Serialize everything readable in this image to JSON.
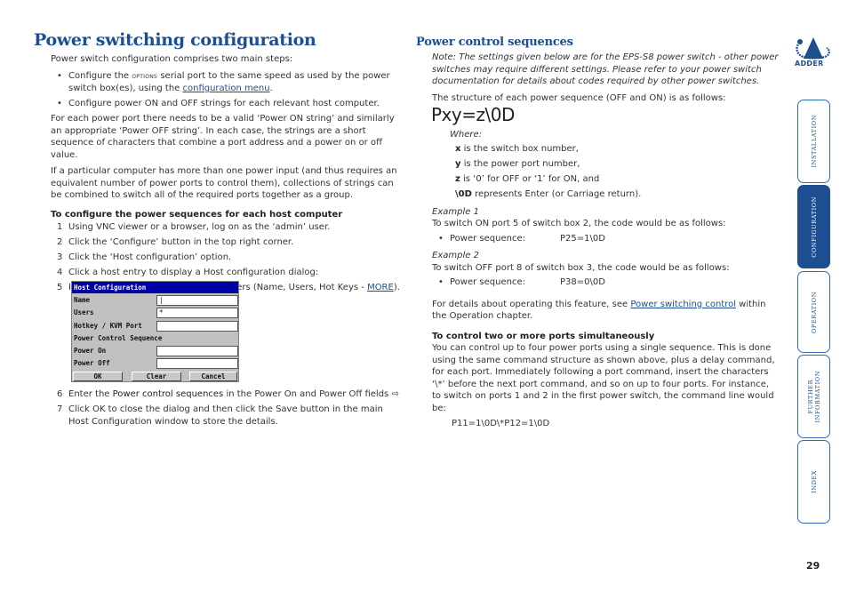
{
  "left": {
    "title": "Power switching configuration",
    "intro": "Power switch configuration comprises two main steps:",
    "bullet1_pre": "Configure the ",
    "bullet1_smallcaps": "options",
    "bullet1_mid": " serial port to the same speed as used by the power switch box(es), using the ",
    "bullet1_link": "configuration menu",
    "bullet1_post": ".",
    "bullet2": "Configure power ON and OFF strings for each relevant host computer.",
    "para1": "For each power port there needs to be a valid ‘Power ON string’ and similarly an appropriate ‘Power OFF string’. In each case, the strings are a short sequence of characters that combine a port address and a power on or off value.",
    "para2": "If a particular computer has more than one power input (and thus requires an equivalent number of power ports to control them), collections of strings can be combined to switch all of the required ports together as a group.",
    "procedure_heading": "To configure the power sequences for each host computer",
    "steps": [
      {
        "num": "1",
        "text": "Using VNC viewer or a browser, log on as the ‘admin’ user."
      },
      {
        "num": "2",
        "text": "Click the ‘Configure’ button in the top right corner."
      },
      {
        "num": "3",
        "text": "Click the ‘Host configuration’ option."
      },
      {
        "num": "4",
        "text": "Click a host entry to display a Host configuration dialog:"
      },
      {
        "num": "5",
        "text_pre": "If necessary, configure other parameters (Name, Users, Hot Keys - ",
        "link": "MORE",
        "text_post": ")."
      }
    ],
    "step6": {
      "num": "6",
      "pre": "Enter the ",
      "bold": "Power control sequences",
      "post": " in the Power On and Power Off fields ⇨"
    },
    "step7": {
      "num": "7",
      "text": "Click OK to close the dialog and then click the Save button in the main Host Configuration window to store the details."
    }
  },
  "dialog": {
    "title": "Host Configuration",
    "name_label": "Name",
    "name_value": "|",
    "users_label": "Users",
    "users_value": "*",
    "hotkey_label": "Hotkey / KVM Port",
    "hotkey_value": "",
    "section_label": "Power Control Sequence",
    "power_on_label": "Power On",
    "power_on_value": "",
    "power_off_label": "Power Off",
    "power_off_value": "",
    "ok": "OK",
    "clear": "Clear",
    "cancel": "Cancel"
  },
  "right": {
    "title": "Power control sequences",
    "note": "Note: The settings given below are for the EPS-S8 power switch - other power switches may require different settings. Please refer to your power switch documentation for details about codes required by other power switches.",
    "structure": "The structure of each power sequence (OFF and ON) is as follows:",
    "formula": "Pxy=z\\0D",
    "where": "Where:",
    "where_items": [
      {
        "key": "x",
        "text": " is the switch box number,"
      },
      {
        "key": "y",
        "text": " is the power port number,"
      },
      {
        "key": "z",
        "text": " is ‘0’ for OFF or ‘1’ for ON, and"
      },
      {
        "key": "\\0D",
        "text": " represents Enter (or Carriage return)."
      }
    ],
    "example1_label": "Example 1",
    "example1_text": "To switch ON port 5 of switch box 2, the code would be as follows:",
    "example1_seq_label": "Power sequence:",
    "example1_seq_value": "P25=1\\0D",
    "example2_label": "Example 2",
    "example2_text": "To switch OFF port 8 of switch box 3, the code would be as follows:",
    "example2_seq_label": "Power sequence:",
    "example2_seq_value": "P38=0\\0D",
    "details_pre": "For details about operating this feature, see ",
    "details_link": "Power switching control",
    "details_post": " within the Operation chapter.",
    "multi_heading": "To control two or more ports simultaneously",
    "multi_text": "You can control up to four power ports using a single sequence. This is done using the same command structure as shown above, plus a delay command, for each port. Immediately following a port command, insert the characters ‘\\*’ before the next port command, and so on up to four ports. For instance, to switch on ports 1 and 2 in the first power switch, the command line would be:",
    "multi_code": "P11=1\\0D\\*P12=1\\0D"
  },
  "sidebar": {
    "logo_text": "ADDER",
    "tabs": [
      {
        "label": "INSTALLATION",
        "active": false
      },
      {
        "label": "CONFIGURATION",
        "active": true
      },
      {
        "label": "OPERATION",
        "active": false
      },
      {
        "label": "FURTHER\nINFORMATION",
        "active": false
      },
      {
        "label": "INDEX",
        "active": false
      }
    ]
  },
  "page_number": "29",
  "colors": {
    "heading": "#1c4e91",
    "link": "#1c4e91",
    "active_tab": "#1c4e91",
    "dialog_title": "#0000a8"
  }
}
